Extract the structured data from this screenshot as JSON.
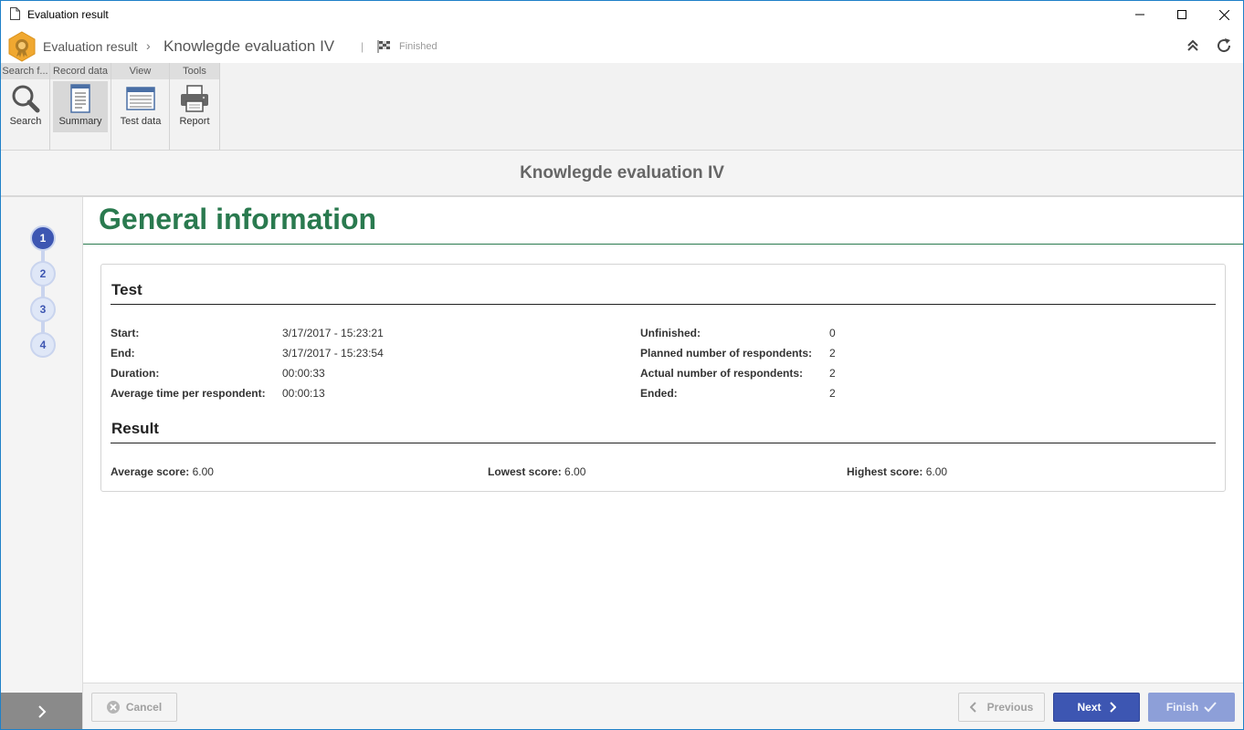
{
  "window": {
    "title": "Evaluation result"
  },
  "header": {
    "breadcrumb_root": "Evaluation result",
    "breadcrumb_current": "Knowlegde evaluation IV",
    "status": "Finished",
    "icons": [
      "collapse-icon",
      "refresh-icon"
    ]
  },
  "ribbon": {
    "groups": [
      {
        "label": "Search f...",
        "buttons": [
          {
            "label": "Search",
            "icon": "magnifier-icon"
          }
        ]
      },
      {
        "label": "Record data",
        "buttons": [
          {
            "label": "Summary",
            "icon": "document-icon",
            "active": true
          }
        ]
      },
      {
        "label": "View",
        "buttons": [
          {
            "label": "Test data",
            "icon": "table-icon"
          }
        ]
      },
      {
        "label": "Tools",
        "buttons": [
          {
            "label": "Report",
            "icon": "printer-icon"
          }
        ]
      }
    ]
  },
  "page_title": "Knowlegde evaluation IV",
  "stepper": {
    "steps": [
      "1",
      "2",
      "3",
      "4"
    ],
    "active_step": "1"
  },
  "section_heading": "General information",
  "test": {
    "title": "Test",
    "left": [
      {
        "label": "Start:",
        "value": "3/17/2017 - 15:23:21"
      },
      {
        "label": "End:",
        "value": "3/17/2017 - 15:23:54"
      },
      {
        "label": "Duration:",
        "value": "00:00:33"
      },
      {
        "label": "Average time per respondent:",
        "value": "00:00:13"
      }
    ],
    "right": [
      {
        "label": "Unfinished:",
        "value": "0"
      },
      {
        "label": "Planned number of respondents:",
        "value": "2"
      },
      {
        "label": "Actual number of respondents:",
        "value": "2"
      },
      {
        "label": "Ended:",
        "value": "2"
      }
    ]
  },
  "result": {
    "title": "Result",
    "items": [
      {
        "label": "Average score:",
        "value": "6.00"
      },
      {
        "label": "Lowest score:",
        "value": "6.00"
      },
      {
        "label": "Highest score:",
        "value": "6.00"
      }
    ]
  },
  "footer": {
    "cancel": "Cancel",
    "previous": "Previous",
    "next": "Next",
    "finish": "Finish"
  },
  "colors": {
    "accent_blue": "#3d56b2",
    "heading_green": "#2a7a4f",
    "window_border": "#1e80c8"
  }
}
